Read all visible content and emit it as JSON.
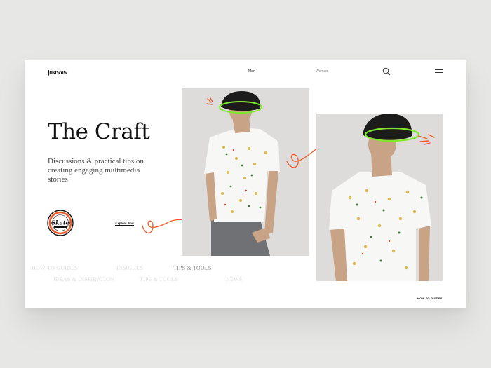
{
  "header": {
    "logo": "justwow",
    "nav": [
      "Man",
      "Woman"
    ],
    "search_icon": "search-icon",
    "menu_icon": "hamburger-menu-icon"
  },
  "hero": {
    "title": "The Craft",
    "description": "Discussions & practical tips on creating engaging multimedia stories",
    "cta": "Explore Now",
    "badge_text": "Skate"
  },
  "tags": {
    "row1": [
      "HOW-TO GUIDES",
      "INSIGHTS",
      "TIPS & TOOLS"
    ],
    "row2": [
      "IDEAS & INSPIRATION",
      "TIPS & TOOLS",
      "NEWS"
    ]
  },
  "footer": {
    "link": "HOW-TO GUIDES"
  },
  "colors": {
    "accent": "#f05a28",
    "background": "#e7e7e6",
    "card": "#ffffff",
    "text": "#111111"
  }
}
